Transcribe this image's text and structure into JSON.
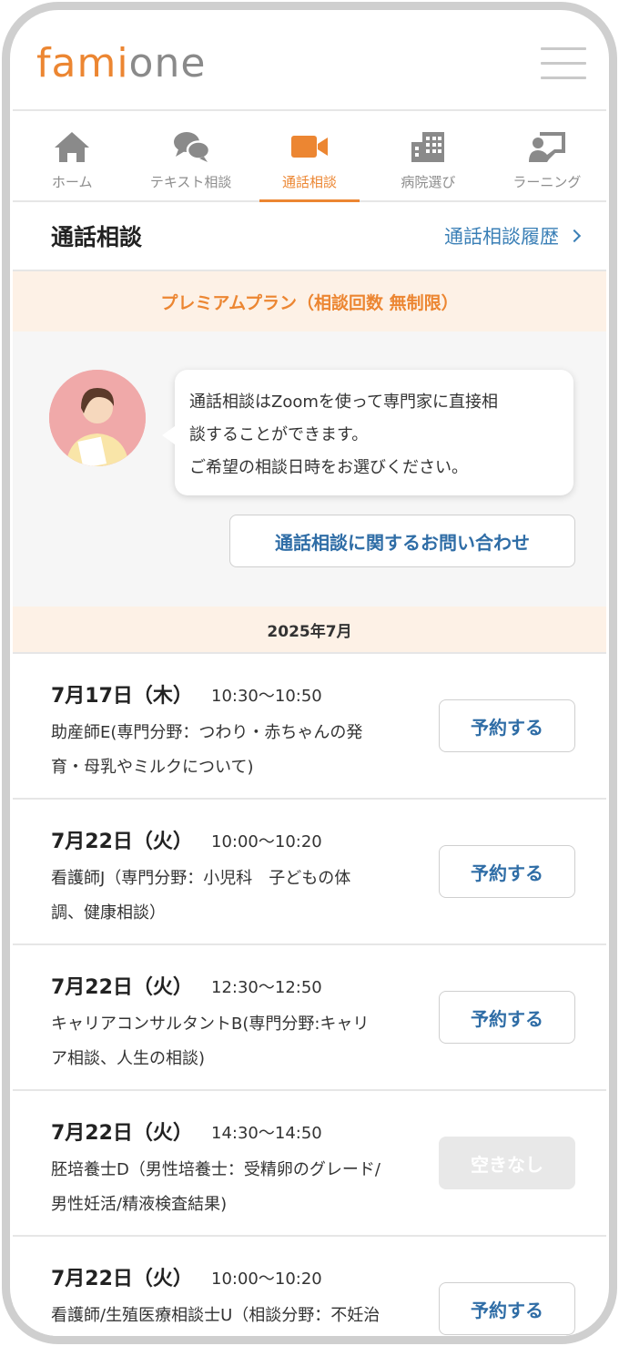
{
  "brand": {
    "logo_part1": "fami",
    "logo_part2": "one"
  },
  "nav": {
    "items": [
      {
        "label": "ホーム",
        "icon": "home-icon"
      },
      {
        "label": "テキスト相談",
        "icon": "chat-bubbles-icon"
      },
      {
        "label": "通話相談",
        "icon": "video-camera-icon",
        "active": true
      },
      {
        "label": "病院選び",
        "icon": "building-icon"
      },
      {
        "label": "ラーニング",
        "icon": "presentation-icon"
      }
    ]
  },
  "page": {
    "title": "通話相談",
    "history_link": "通話相談履歴"
  },
  "plan_banner": "プレミアムプラン（相談回数 無制限）",
  "intro": {
    "lines": [
      "通話相談はZoomを使って専門家に直接相",
      "談することができます。",
      "ご希望の相談日時をお選びください。"
    ],
    "contact_button": "通話相談に関するお問い合わせ"
  },
  "month_header": "2025年7月",
  "slots": [
    {
      "date": "7月17日（木）",
      "time": "10:30〜10:50",
      "desc1": "助産師E(専門分野：つわり・赤ちゃんの発",
      "desc2": "育・母乳やミルクについて)",
      "button": "予約する",
      "available": true
    },
    {
      "date": "7月22日（火）",
      "time": "10:00〜10:20",
      "desc1": "看護師J（専門分野：小児科　子どもの体",
      "desc2": "調、健康相談）",
      "button": "予約する",
      "available": true
    },
    {
      "date": "7月22日（火）",
      "time": "12:30〜12:50",
      "desc1": "キャリアコンサルタントB(専門分野:キャリ",
      "desc2": "ア相談、人生の相談)",
      "button": "予約する",
      "available": true
    },
    {
      "date": "7月22日（火）",
      "time": "14:30〜14:50",
      "desc1": "胚培養士D（男性培養士：受精卵のグレード/",
      "desc2": "男性妊活/精液検査結果)",
      "button": "空きなし",
      "available": false
    },
    {
      "date": "7月22日（火）",
      "time": "10:00〜10:20",
      "desc1": "看護師/生殖医療相談士U（相談分野：不妊治",
      "desc2": "",
      "button": "予約する",
      "available": true
    }
  ],
  "colors": {
    "accent": "#ec8632",
    "link": "#3a7fb6",
    "band": "#fdf1e6"
  }
}
